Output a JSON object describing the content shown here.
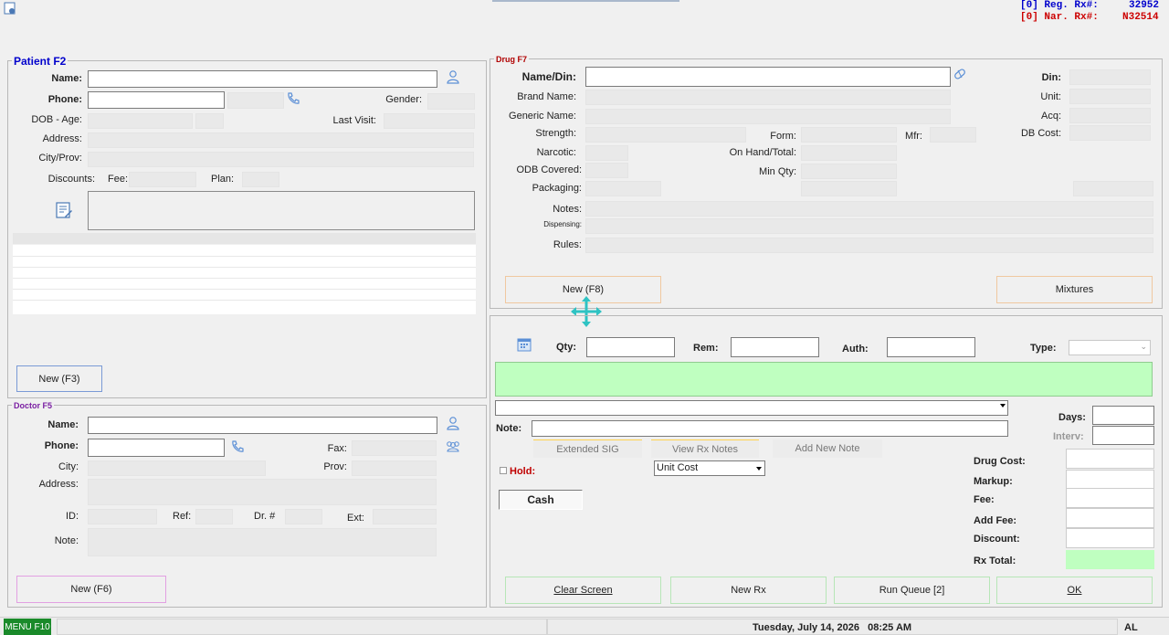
{
  "top": {
    "reg_rx": "[0] Reg. Rx#:",
    "reg_rx_value": "32952",
    "nar_rx": "[0] Nar. Rx#:",
    "nar_rx_value": "N32514"
  },
  "patient": {
    "title": "Patient F2",
    "name_label": "Name:",
    "phone_label": "Phone:",
    "gender_label": "Gender:",
    "dob_label": "DOB - Age:",
    "last_visit_label": "Last Visit:",
    "address_label": "Address:",
    "cityprov_label": "City/Prov:",
    "discounts_label": "Discounts:",
    "fee_label": "Fee:",
    "plan_label": "Plan:",
    "new_button": "New (F3)"
  },
  "doctor": {
    "title": "Doctor F5",
    "name_label": "Name:",
    "phone_label": "Phone:",
    "fax_label": "Fax:",
    "city_label": "City:",
    "prov_label": "Prov:",
    "address_label": "Address:",
    "id_label": "ID:",
    "ref_label": "Ref:",
    "dr_label": "Dr. #",
    "ext_label": "Ext:",
    "note_label": "Note:",
    "new_button": "New (F6)"
  },
  "drug": {
    "title": "Drug F7",
    "namedin_label": "Name/Din:",
    "din_label": "Din:",
    "brand_label": "Brand Name:",
    "unit_label": "Unit:",
    "generic_label": "Generic Name:",
    "acq_label": "Acq:",
    "strength_label": "Strength:",
    "form_label": "Form:",
    "mfr_label": "Mfr:",
    "dbcost_label": "DB Cost:",
    "narcotic_label": "Narcotic:",
    "onhand_label": "On Hand/Total:",
    "odb_label": "ODB Covered:",
    "minqty_label": "Min Qty:",
    "packaging_label": "Packaging:",
    "notes_label": "Notes:",
    "dispensing_label": "Dispensing:",
    "rules_label": "Rules:",
    "new_button": "New (F8)",
    "mixtures_button": "Mixtures"
  },
  "rx": {
    "qty_label": "Qty:",
    "rem_label": "Rem:",
    "auth_label": "Auth:",
    "type_label": "Type:",
    "days_label": "Days:",
    "interv_label": "Interv:",
    "note_label": "Note:",
    "extended_sig": "Extended SIG",
    "view_rx_notes": "View Rx Notes",
    "add_new_note": "Add New Note",
    "hold_label": "Hold:",
    "cost_select": "Unit Cost",
    "cash_button": "Cash",
    "drug_cost_label": "Drug Cost:",
    "markup_label": "Markup:",
    "fee_label": "Fee:",
    "add_fee_label": "Add Fee:",
    "discount_label": "Discount:",
    "rx_total_label": "Rx Total:",
    "clear_screen": "Clear Screen",
    "new_rx": "New Rx",
    "run_queue": "Run Queue [2]",
    "ok": "OK"
  },
  "status": {
    "menu": "MENU F10",
    "datetime": "Tuesday, July 14, 2026   08:25 AM",
    "user": "AL"
  },
  "colors": {
    "accent_green": "#bfffc0",
    "title_blue": "#0000cc",
    "drug_title_red": "#b00000",
    "doctor_title_purple": "#7a1fa2",
    "menu_green": "#1a8a2a"
  }
}
